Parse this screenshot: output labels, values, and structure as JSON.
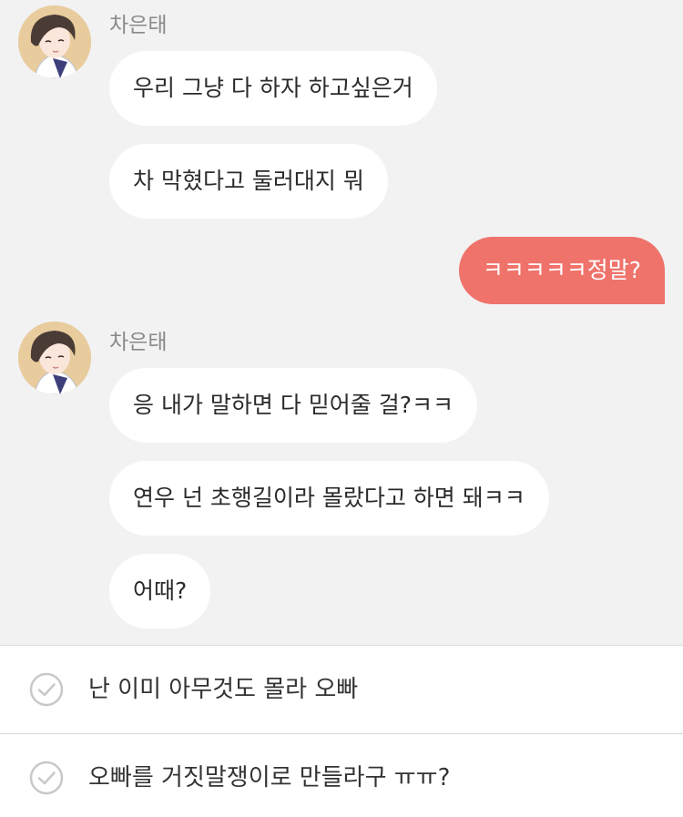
{
  "chat": {
    "groups": [
      {
        "sender": "차은태",
        "messages": [
          "우리 그냥 다 하자 하고싶은거",
          "차 막혔다고 둘러대지 뭐"
        ]
      },
      {
        "outgoing": "ㅋㅋㅋㅋㅋ정말?"
      },
      {
        "sender": "차은태",
        "messages": [
          "응 내가 말하면 다 믿어줄 걸?ㅋㅋ",
          "연우 넌 초행길이라 몰랐다고 하면 돼ㅋㅋ",
          "어때?"
        ]
      }
    ]
  },
  "choices": [
    {
      "label": "난 이미 아무것도 몰라 오빠",
      "icon": "check-circle-icon"
    },
    {
      "label": "오빠를 거짓말쟁이로 만들라구 ㅠㅠ?",
      "icon": "check-circle-icon"
    }
  ],
  "colors": {
    "background": "#f2f2f2",
    "incoming_bubble": "#ffffff",
    "outgoing_bubble": "#ef736b",
    "sender_name": "#8a8a8a"
  }
}
